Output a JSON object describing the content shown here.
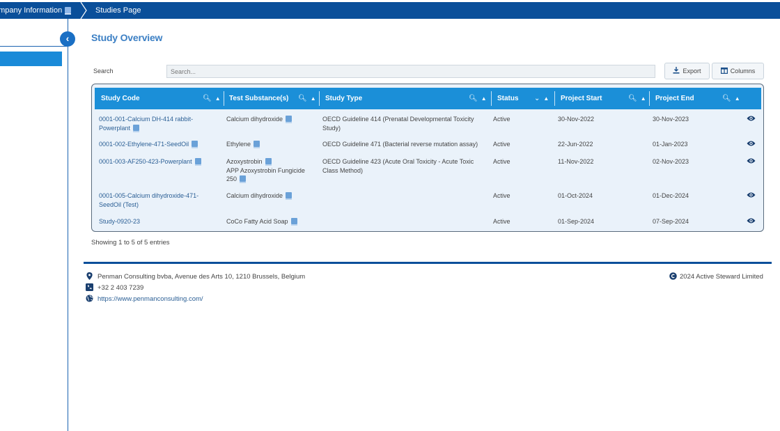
{
  "breadcrumb": {
    "items": [
      "ompany Information",
      "Studies Page"
    ]
  },
  "page": {
    "title": "Study Overview"
  },
  "search": {
    "label": "Search",
    "placeholder": "Search..."
  },
  "toolbar": {
    "export_label": "Export",
    "columns_label": "Columns"
  },
  "table": {
    "columns": [
      "Study Code",
      "Test Substance(s)",
      "Study Type",
      "Status",
      "Project Start",
      "Project End"
    ],
    "rows": [
      {
        "code_line1": "0001-001-Calcium DH-414 rabbit-",
        "code_line2": "Powerplant",
        "substance_line1": "Calcium dihydroxide",
        "substance_line2": "",
        "substance_line3": "",
        "type_line1": "OECD Guideline 414 (Prenatal Developmental Toxicity",
        "type_line2": "Study)",
        "status": "Active",
        "start": "30-Nov-2022",
        "end": "30-Nov-2023"
      },
      {
        "code_line1": "0001-002-Ethylene-471-SeedOil",
        "code_line2": "",
        "substance_line1": "Ethylene",
        "substance_line2": "",
        "substance_line3": "",
        "type_line1": "OECD Guideline 471 (Bacterial reverse mutation assay)",
        "type_line2": "",
        "status": "Active",
        "start": "22-Jun-2022",
        "end": "01-Jan-2023"
      },
      {
        "code_line1": "0001-003-AF250-423-Powerplant",
        "code_line2": "",
        "substance_line1": "Azoxystrobin",
        "substance_line2": "APP Azoxystrobin Fungicide",
        "substance_line3": "250",
        "type_line1": "OECD Guideline 423 (Acute Oral Toxicity - Acute Toxic",
        "type_line2": "Class Method)",
        "status": "Active",
        "start": "11-Nov-2022",
        "end": "02-Nov-2023"
      },
      {
        "code_line1": "0001-005-Calcium dihydroxide-471-",
        "code_line2": "SeedOil (Test)",
        "substance_line1": "Calcium dihydroxide",
        "substance_line2": "",
        "substance_line3": "",
        "type_line1": "",
        "type_line2": "",
        "status": "Active",
        "start": "01-Oct-2024",
        "end": "01-Dec-2024"
      },
      {
        "code_line1": "Study-0920-23",
        "code_line2": "",
        "substance_line1": "CoCo Fatty Acid Soap",
        "substance_line2": "",
        "substance_line3": "",
        "type_line1": "",
        "type_line2": "",
        "status": "Active",
        "start": "01-Sep-2024",
        "end": "07-Sep-2024"
      }
    ]
  },
  "entries_info": "Showing 1 to 5 of 5 entries",
  "footer": {
    "address": "Penman Consulting bvba, Avenue des Arts 10, 1210 Brussels, Belgium",
    "phone": "+32 2 403 7239",
    "website": "https://www.penmanconsulting.com/",
    "copyright": "2024 Active Steward Limited"
  },
  "icons": {
    "search": "search-icon",
    "sort": "sort-icon",
    "view": "eye-icon",
    "export": "download-icon",
    "columns": "columns-icon",
    "location": "map-pin-icon",
    "phone": "phone-icon",
    "web": "globe-icon",
    "copyright": "copyright-icon"
  },
  "colors": {
    "topbar": "#0a4f9a",
    "table_header": "#1b8fd8",
    "table_body": "#eaf2fa",
    "link": "#2b5f95",
    "title": "#3b7fc4"
  }
}
